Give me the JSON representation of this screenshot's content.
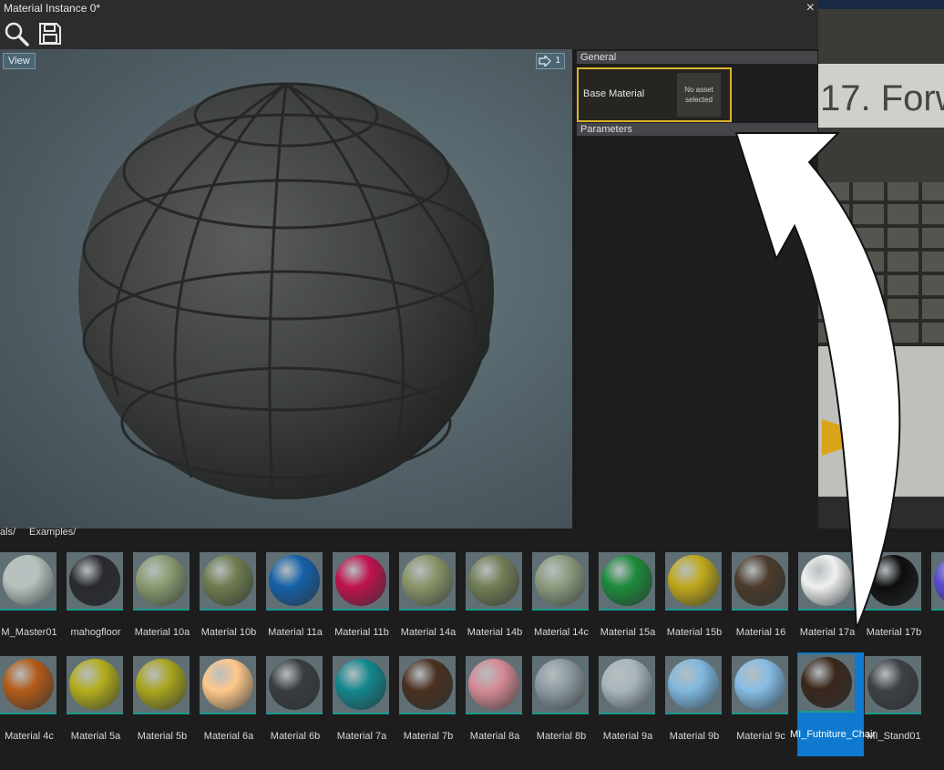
{
  "window": {
    "title": "Material Instance 0*",
    "close_glyph": "×"
  },
  "toolbar": {
    "search_icon": "search-icon",
    "save_icon": "save-icon"
  },
  "viewport": {
    "view_button": "View",
    "camera_speed": "1"
  },
  "properties": {
    "general_header": "General",
    "base_material_label": "Base Material",
    "base_material_value": "No asset selected",
    "parameters_header": "Parameters"
  },
  "scene": {
    "sign_text": "17. Forw"
  },
  "browser": {
    "breadcrumbs": [
      "als/",
      "Examples/"
    ],
    "row1": [
      {
        "label": "M_Master01",
        "color": "#b7c2bd"
      },
      {
        "label": "mahogfloor",
        "color": "#2a2a2e"
      },
      {
        "label": "Material 10a",
        "color": "#8b9a70"
      },
      {
        "label": "Material 10b",
        "color": "#6f7c4e"
      },
      {
        "label": "Material 11a",
        "color": "#1560a8"
      },
      {
        "label": "Material 11b",
        "color": "#c0124e"
      },
      {
        "label": "Material 14a",
        "color": "#8a9468"
      },
      {
        "label": "Material 14b",
        "color": "#737e55"
      },
      {
        "label": "Material 14c",
        "color": "#8d9a7e"
      },
      {
        "label": "Material 15a",
        "color": "#1d8a3a"
      },
      {
        "label": "Material 15b",
        "color": "#c0a81a"
      },
      {
        "label": "Material 16",
        "color": "#4b3a2a"
      },
      {
        "label": "Material 17a",
        "color": "#f0f0f0"
      },
      {
        "label": "Material 17b",
        "color": "#0d0d0d"
      },
      {
        "label": "",
        "color": "#5a4bd0"
      }
    ],
    "row2": [
      {
        "label": "Material 4c",
        "color": "#b45a18"
      },
      {
        "label": "Material 5a",
        "color": "#b3ad1c"
      },
      {
        "label": "Material 5b",
        "color": "#a9a51e"
      },
      {
        "label": "Material 6a",
        "color": "#ffc88a"
      },
      {
        "label": "Material 6b",
        "color": "#3a3c40"
      },
      {
        "label": "Material 7a",
        "color": "#12878e"
      },
      {
        "label": "Material 7b",
        "color": "#4a3020"
      },
      {
        "label": "Material 8a",
        "color": "#d48a94"
      },
      {
        "label": "Material 8b",
        "color": "#8d9aa0"
      },
      {
        "label": "Material 9a",
        "color": "#a9b6bc"
      },
      {
        "label": "Material 9b",
        "color": "#7fb8e0"
      },
      {
        "label": "Material 9c",
        "color": "#86bde6"
      },
      {
        "label": "MI_Futniture_Chair",
        "color": "#3a261a",
        "selected": true
      },
      {
        "label": "MI_Stand01",
        "color": "#3e4044"
      }
    ]
  },
  "colors": {
    "accent_selected": "#0e79cf",
    "highlight_border": "#d9b52a",
    "thumb_underline": "#1a9a8a"
  }
}
